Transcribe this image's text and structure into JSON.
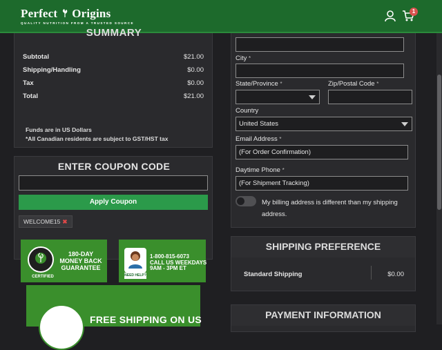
{
  "header": {
    "logo_text_left": "Perfect",
    "logo_text_right": "Origins",
    "logo_tagline": "QUALITY NUTRITION FROM A TRUSTED SOURCE",
    "cart_count": "1",
    "icons": [
      "user-icon",
      "cart-icon"
    ]
  },
  "summary": {
    "title": "SUMMARY",
    "rows": [
      {
        "label": "Subtotal",
        "value": "$21.00"
      },
      {
        "label": "Shipping/Handling",
        "value": "$0.00"
      },
      {
        "label": "Tax",
        "value": "$0.00"
      },
      {
        "label": "Total",
        "value": "$21.00"
      }
    ],
    "note1": "Funds are in US Dollars",
    "note2": "*All Canadian residents are subject to GST/HST tax"
  },
  "coupon": {
    "title": "ENTER COUPON CODE",
    "input_value": "",
    "apply_label": "Apply Coupon",
    "applied_code": "WELCOME15",
    "remove_symbol": "✖"
  },
  "banners": {
    "guarantee": {
      "line1": "180-DAY",
      "line2": "MONEY BACK",
      "line3": "GUARANTEE",
      "seal_text": "CERTIFIED"
    },
    "phone": {
      "number": "1-800-815-6073",
      "line2": "CALL US WEEKDAYS",
      "line3": "9AM - 3PM ET",
      "tag": "NEED HELP?"
    },
    "free_shipping": {
      "text": "FREE SHIPPING ON US"
    }
  },
  "form": {
    "city": {
      "label": "City",
      "req": "*",
      "value": ""
    },
    "state": {
      "label": "State/Province",
      "req": "*",
      "value": ""
    },
    "zip": {
      "label": "Zip/Postal Code",
      "req": "*",
      "value": ""
    },
    "country": {
      "label": "Country",
      "value": "United States"
    },
    "email": {
      "label": "Email Address",
      "req": "*",
      "value": "(For Order Confirmation)"
    },
    "phone": {
      "label": "Daytime Phone",
      "req": "*",
      "value": "(For Shipment Tracking)"
    },
    "billing_toggle_label": "My billing address is different than my shipping address."
  },
  "shipping": {
    "title": "SHIPPING PREFERENCE",
    "option": "Standard Shipping",
    "price": "$0.00"
  },
  "payment": {
    "title": "PAYMENT INFORMATION"
  },
  "colors": {
    "brand_green": "#1d6a2c",
    "button_green": "#2b9a4a",
    "badge_red": "#d9534f"
  }
}
